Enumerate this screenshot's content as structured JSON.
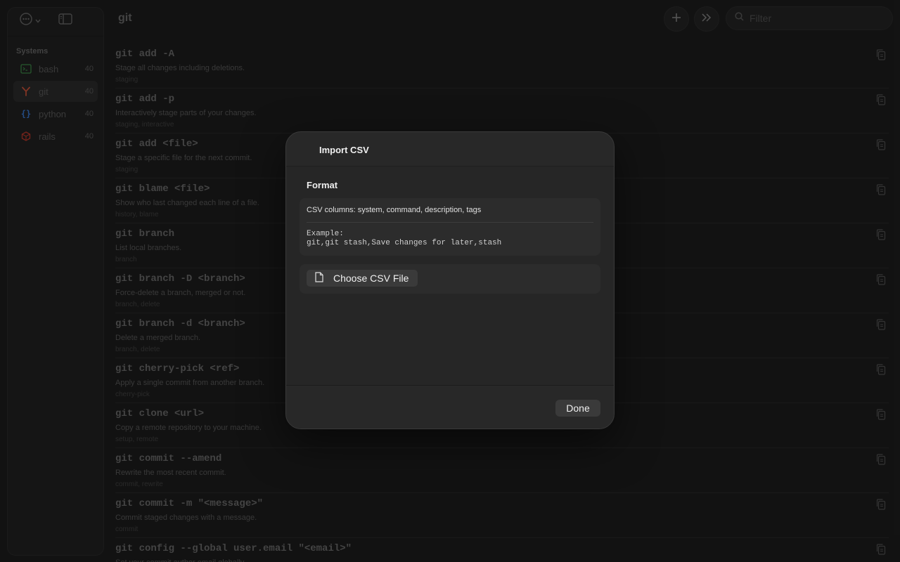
{
  "header": {
    "title": "git",
    "filter_placeholder": "Filter"
  },
  "sidebar": {
    "section": "Systems",
    "items": [
      {
        "label": "bash",
        "count": "40",
        "icon": "terminal-icon",
        "color": "#3f8f4a"
      },
      {
        "label": "git",
        "count": "40",
        "icon": "git-branch-icon",
        "color": "#d0543a"
      },
      {
        "label": "python",
        "count": "40",
        "icon": "braces-icon",
        "color": "#3a7bd5"
      },
      {
        "label": "rails",
        "count": "40",
        "icon": "ruby-icon",
        "color": "#c0392b"
      }
    ]
  },
  "commands": [
    {
      "cmd": "git add -A",
      "desc": "Stage all changes including deletions.",
      "tags": "staging"
    },
    {
      "cmd": "git add -p",
      "desc": "Interactively stage parts of your changes.",
      "tags": "staging, interactive"
    },
    {
      "cmd": "git add <file>",
      "desc": "Stage a specific file for the next commit.",
      "tags": "staging"
    },
    {
      "cmd": "git blame <file>",
      "desc": "Show who last changed each line of a file.",
      "tags": "history, blame"
    },
    {
      "cmd": "git branch",
      "desc": "List local branches.",
      "tags": "branch"
    },
    {
      "cmd": "git branch -D <branch>",
      "desc": "Force-delete a branch, merged or not.",
      "tags": "branch, delete"
    },
    {
      "cmd": "git branch -d <branch>",
      "desc": "Delete a merged branch.",
      "tags": "branch, delete"
    },
    {
      "cmd": "git cherry-pick <ref>",
      "desc": "Apply a single commit from another branch.",
      "tags": "cherry-pick"
    },
    {
      "cmd": "git clone <url>",
      "desc": "Copy a remote repository to your machine.",
      "tags": "setup, remote"
    },
    {
      "cmd": "git commit --amend",
      "desc": "Rewrite the most recent commit.",
      "tags": "commit, rewrite"
    },
    {
      "cmd": "git commit -m \"<message>\"",
      "desc": "Commit staged changes with a message.",
      "tags": "commit"
    },
    {
      "cmd": "git config --global user.email \"<email>\"",
      "desc": "Set your commit author email globally.",
      "tags": ""
    }
  ],
  "modal": {
    "title": "Import CSV",
    "format_heading": "Format",
    "columns_text": "CSV columns: system, command, description, tags",
    "example_label": "Example:",
    "example_line": "git,git stash,Save changes for later,stash",
    "choose_label": "Choose CSV File",
    "done_label": "Done"
  }
}
